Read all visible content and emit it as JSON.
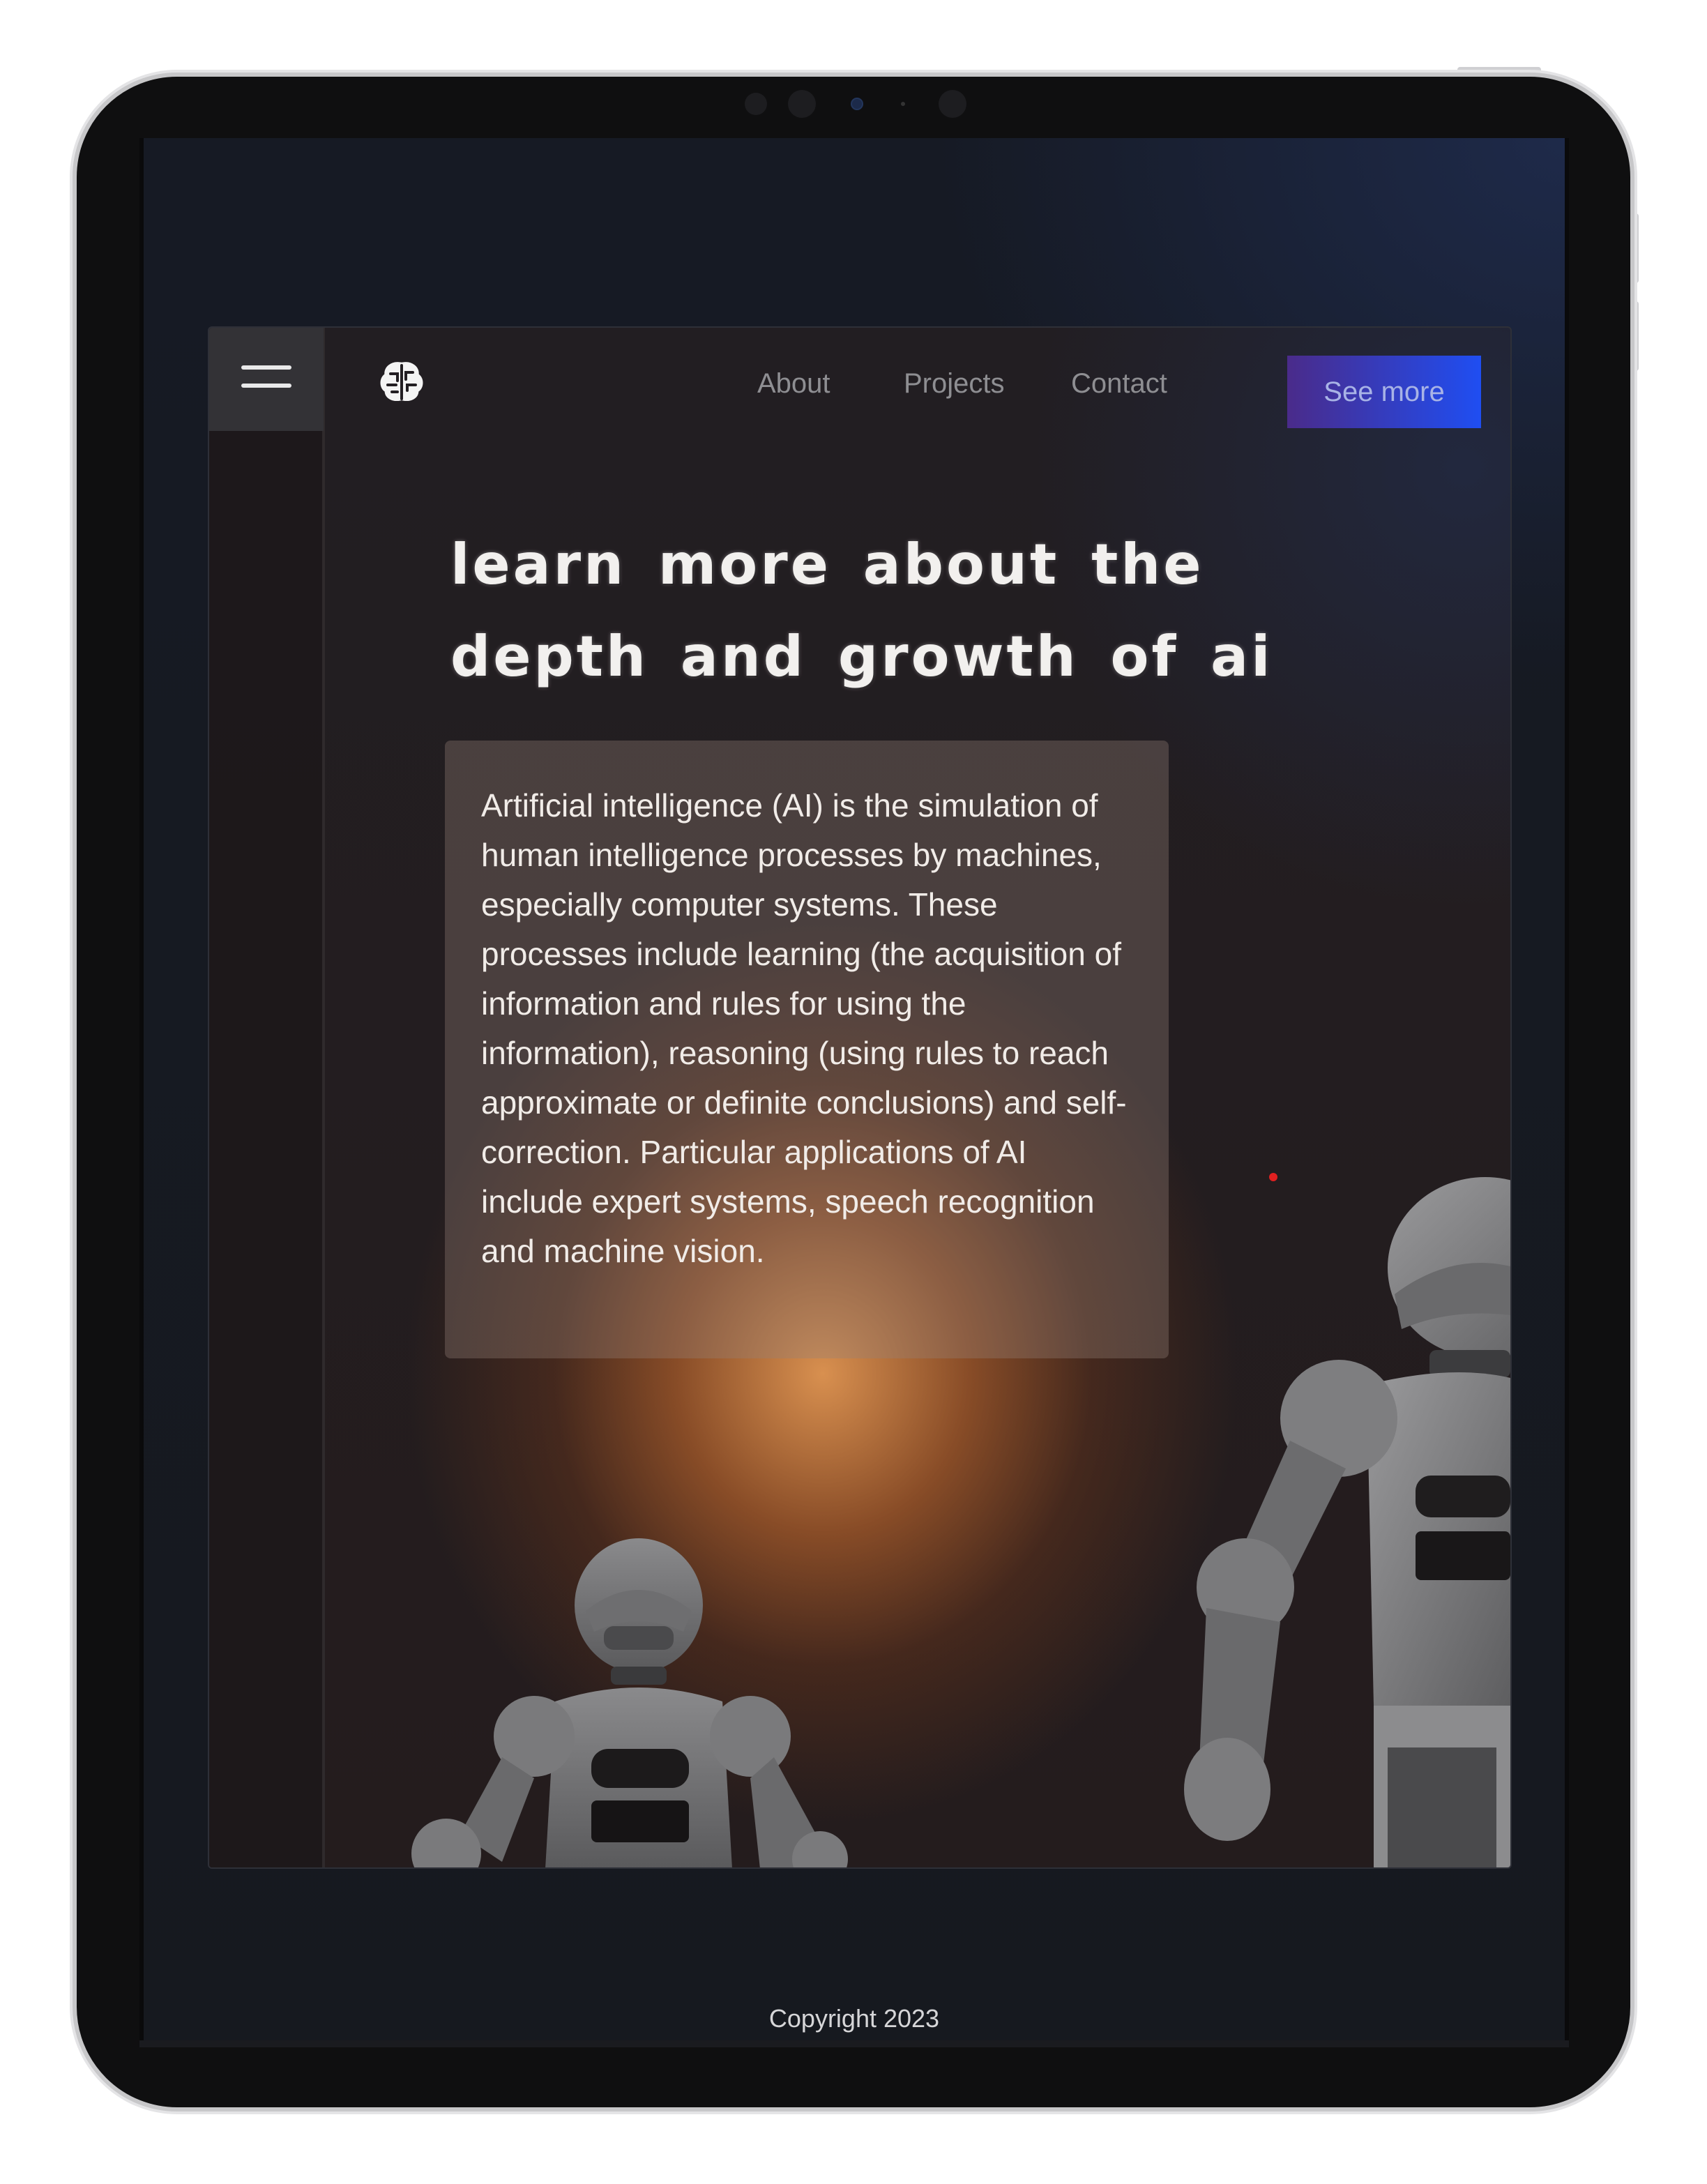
{
  "nav": {
    "about_label": "About",
    "projects_label": "Projects",
    "contact_label": "Contact",
    "cta_label": "See more"
  },
  "icons": {
    "menu": "hamburger-icon",
    "logo": "brain-logo-icon"
  },
  "hero": {
    "title": "learn more about the depth and growth of ai",
    "description": "Artificial intelligence (AI) is the simulation of human intelligence processes by machines, especially computer systems. These processes include learning (the acquisition of information and rules for using the information), reasoning (using rules to reach approximate or definite conclusions) and self-correction. Particular applications of AI include expert systems, speech recognition and machine vision."
  },
  "footer": {
    "copyright": "Copyright 2023"
  },
  "colors": {
    "cta_start": "#4a2b8a",
    "cta_end": "#1f4ef2",
    "glow": "#e29652",
    "background": "#221e22"
  }
}
